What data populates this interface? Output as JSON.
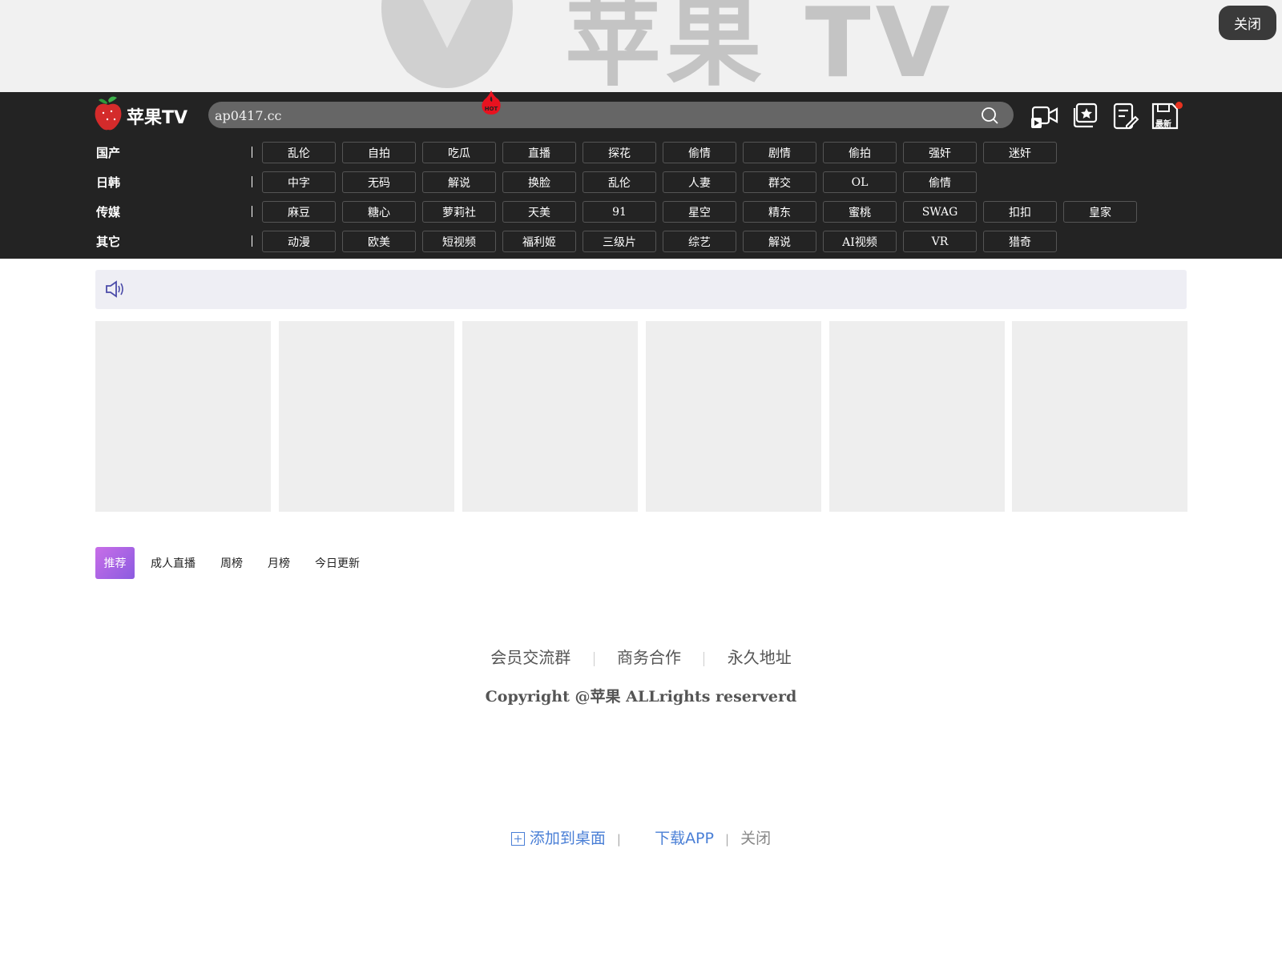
{
  "banner": {
    "title": "苹果 TV",
    "close_label": "关闭"
  },
  "header": {
    "site_name": "苹果TV",
    "search_value": "ap0417.cc",
    "icons": [
      "video-icon",
      "star-collection-icon",
      "edit-note-icon",
      "latest-save-icon"
    ],
    "latest_badge": "最新"
  },
  "categories": [
    {
      "label": "国产",
      "items": [
        "乱伦",
        "自拍",
        "吃瓜",
        "直播",
        "探花",
        "偷情",
        "剧情",
        "偷拍",
        "强奸",
        "迷奸"
      ]
    },
    {
      "label": "日韩",
      "items": [
        "中字",
        "无码",
        "解说",
        "换脸",
        "乱伦",
        "人妻",
        "群交",
        "OL",
        "偷情"
      ]
    },
    {
      "label": "传媒",
      "items": [
        "麻豆",
        "糖心",
        "萝莉社",
        "天美",
        "91",
        "星空",
        "精东",
        "蜜桃",
        "SWAG",
        "扣扣",
        "皇家"
      ]
    },
    {
      "label": "其它",
      "items": [
        "动漫",
        "欧美",
        "短视频",
        "福利姬",
        "三级片",
        "综艺",
        "解说",
        "AI视频",
        "VR",
        "猎奇"
      ]
    }
  ],
  "hot_badge": "HOT",
  "tabs": [
    "推荐",
    "成人直播",
    "周榜",
    "月榜",
    "今日更新"
  ],
  "footer": {
    "links": [
      "会员交流群",
      "商务合作",
      "永久地址"
    ],
    "copyright": "Copyright @苹果 ALLrights reserverd"
  },
  "bottom_bar": {
    "add_label": "添加到桌面",
    "download_label": "下载APP",
    "close_label": "关闭"
  },
  "colors": {
    "header_bg": "#232323",
    "accent": "#8b5be0",
    "link_blue": "#4a7fd6",
    "badge_red": "#e8321f"
  }
}
